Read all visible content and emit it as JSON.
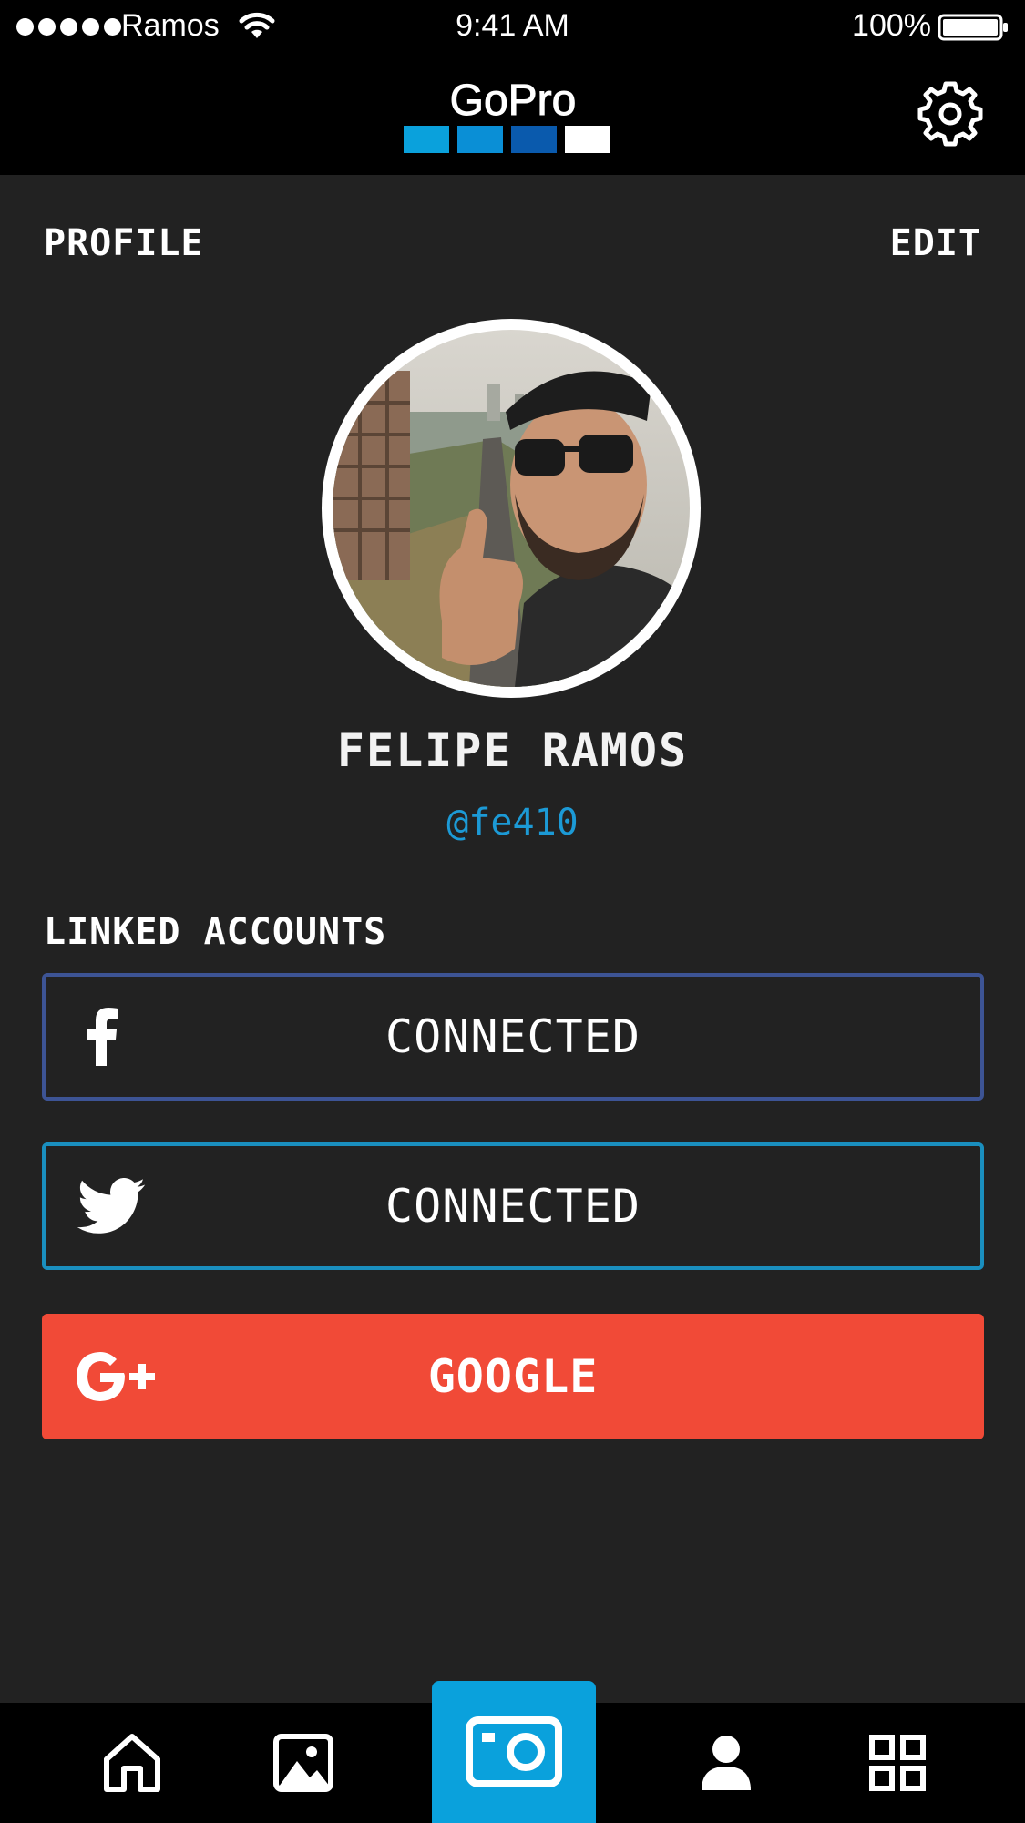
{
  "status_bar": {
    "carrier": "Ramos",
    "time": "9:41 AM",
    "battery": "100%"
  },
  "nav_bar": {
    "logo_text": "GoPro",
    "settings_icon": "gear-icon"
  },
  "profile": {
    "section_title": "PROFILE",
    "edit_label": "EDIT",
    "name": "FELIPE RAMOS",
    "handle": "@fe410"
  },
  "linked_accounts": {
    "title": "LINKED ACCOUNTS",
    "accounts": [
      {
        "service": "facebook",
        "icon": "facebook-icon",
        "label": "CONNECTED",
        "color": "#3d5495"
      },
      {
        "service": "twitter",
        "icon": "twitter-icon",
        "label": "CONNECTED",
        "color": "#1a8fbf"
      },
      {
        "service": "google-plus",
        "icon": "google-plus-icon",
        "label": "GOOGLE",
        "color": "#f14a37"
      }
    ]
  },
  "tab_bar": {
    "active_color": "#0aa1dc",
    "tabs": [
      {
        "name": "home",
        "icon": "home-icon"
      },
      {
        "name": "media",
        "icon": "image-icon"
      },
      {
        "name": "camera",
        "icon": "camera-icon",
        "active": true
      },
      {
        "name": "profile",
        "icon": "user-icon"
      },
      {
        "name": "apps",
        "icon": "grid-icon"
      }
    ]
  },
  "colors": {
    "background": "#222222",
    "bar": "#000000",
    "handle": "#1c9ad6"
  }
}
